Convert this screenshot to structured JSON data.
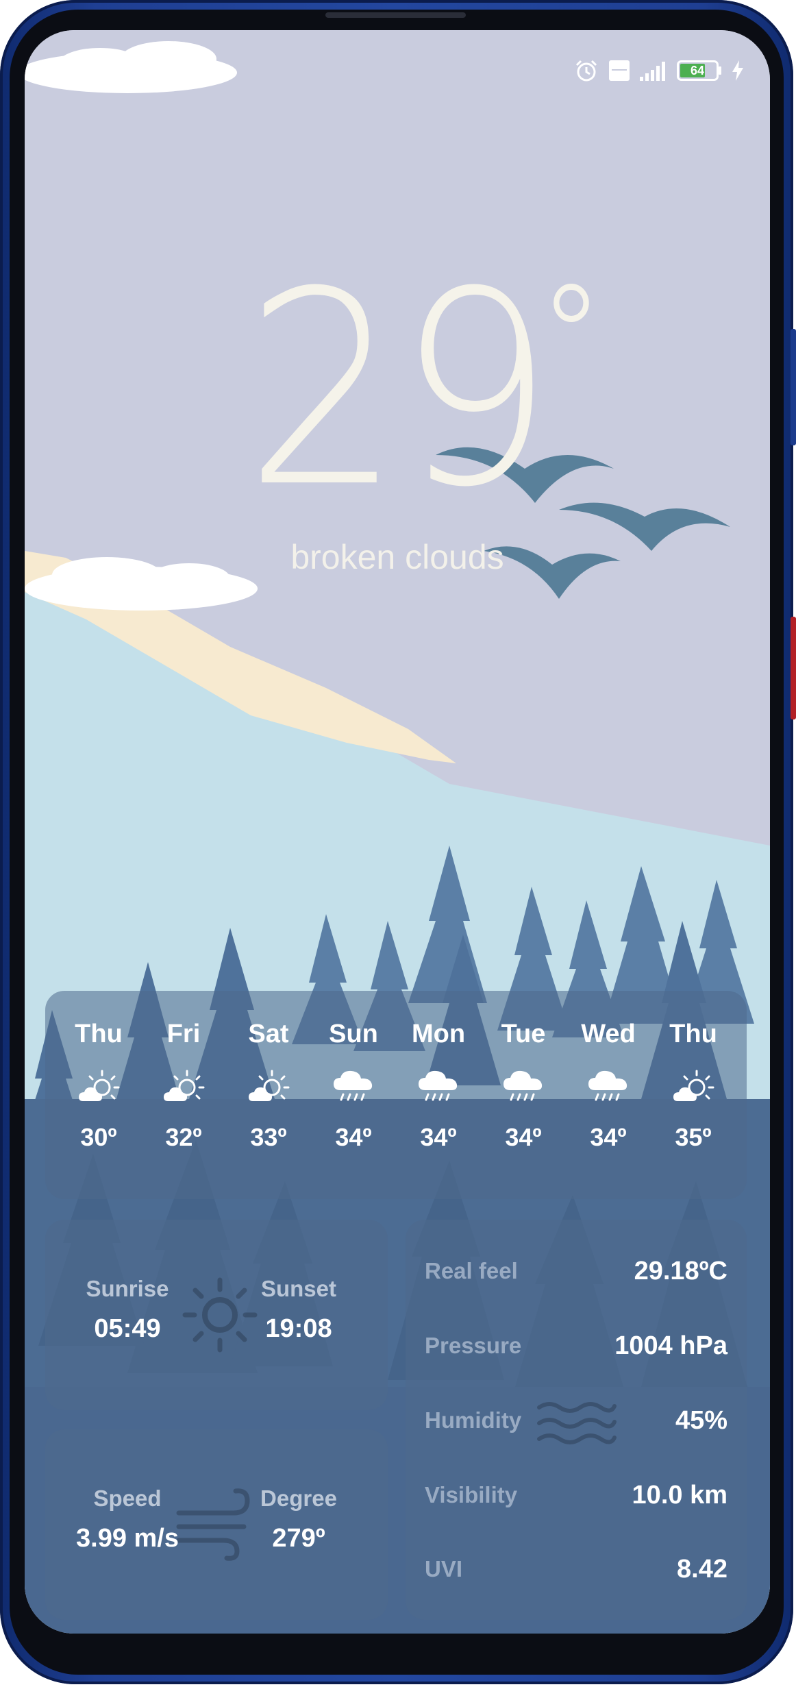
{
  "current": {
    "temperature": "29",
    "condition": "broken clouds"
  },
  "forecast": [
    {
      "day": "Thu",
      "icon": "partly-sunny-icon",
      "temp": "30º"
    },
    {
      "day": "Fri",
      "icon": "partly-sunny-icon",
      "temp": "32º"
    },
    {
      "day": "Sat",
      "icon": "partly-sunny-icon",
      "temp": "33º"
    },
    {
      "day": "Sun",
      "icon": "rain-cloud-icon",
      "temp": "34º"
    },
    {
      "day": "Mon",
      "icon": "rain-cloud-icon",
      "temp": "34º"
    },
    {
      "day": "Tue",
      "icon": "rain-cloud-icon",
      "temp": "34º"
    },
    {
      "day": "Wed",
      "icon": "rain-cloud-icon",
      "temp": "34º"
    },
    {
      "day": "Thu",
      "icon": "partly-sunny-icon",
      "temp": "35º"
    }
  ],
  "sun": {
    "sunrise_label": "Sunrise",
    "sunrise": "05:49",
    "sunset_label": "Sunset",
    "sunset": "19:08"
  },
  "wind": {
    "speed_label": "Speed",
    "speed": "3.99 m/s",
    "degree_label": "Degree",
    "degree": "279º"
  },
  "details": [
    {
      "label": "Real feel",
      "value": "29.18ºC"
    },
    {
      "label": "Pressure",
      "value": "1004 hPa"
    },
    {
      "label": "Humidity",
      "value": "45%"
    },
    {
      "label": "Visibility",
      "value": "10.0 km"
    },
    {
      "label": "UVI",
      "value": "8.42"
    }
  ],
  "status_bar": {
    "battery": "64",
    "icons": [
      "alarm-icon",
      "volte-icon",
      "signal-icon",
      "battery-icon",
      "charging-icon"
    ]
  },
  "colors": {
    "sky": "#c9ccde",
    "text": "#f5f3ea",
    "card": "#4e6a8c",
    "device": "#23479f"
  }
}
